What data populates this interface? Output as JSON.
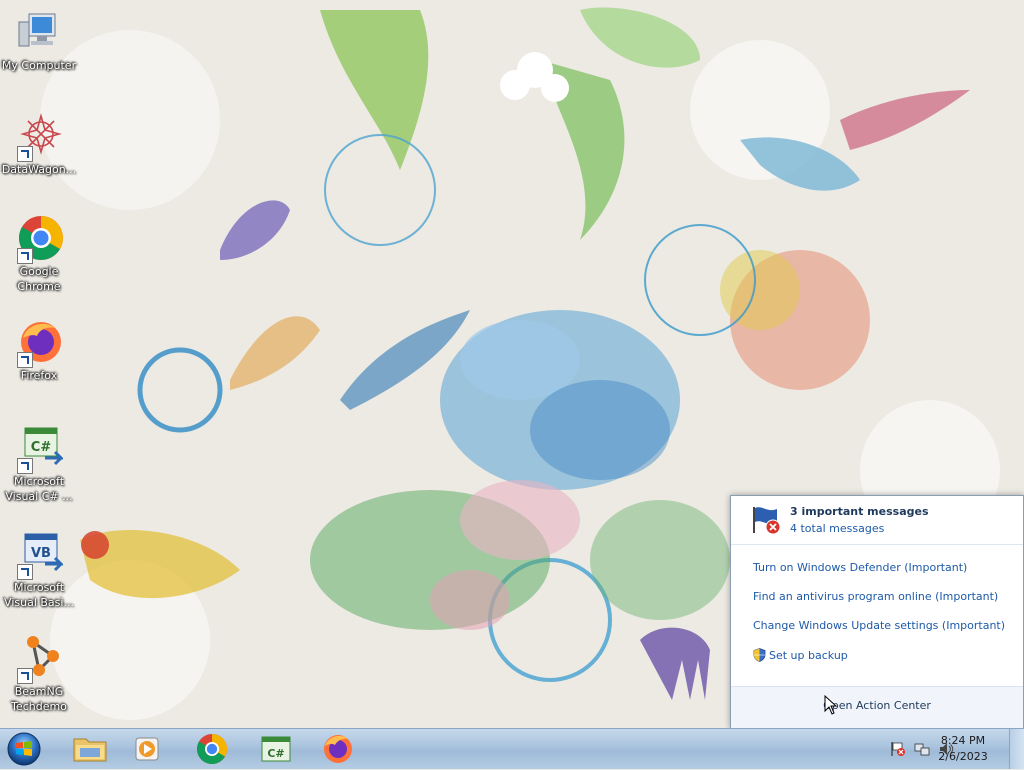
{
  "desktop": {
    "icons": [
      {
        "label": "My Computer",
        "icon": "computer-icon"
      },
      {
        "label": "DataWagon...",
        "icon": "datawagon-icon"
      },
      {
        "label": "Google Chrome",
        "icon": "chrome-icon"
      },
      {
        "label": "Firefox",
        "icon": "firefox-icon"
      },
      {
        "label": "Microsoft Visual C# ...",
        "icon": "visual-csharp-icon"
      },
      {
        "label": "Microsoft Visual Basi...",
        "icon": "visual-basic-icon"
      },
      {
        "label": "BeamNG Techdemo",
        "icon": "beamng-icon"
      }
    ]
  },
  "taskbar": {
    "start_icon": "windows-start-orb",
    "pinned": [
      {
        "name": "file-explorer",
        "icon": "folder-icon"
      },
      {
        "name": "media-player",
        "icon": "media-player-icon"
      },
      {
        "name": "google-chrome",
        "icon": "chrome-icon"
      },
      {
        "name": "visual-csharp",
        "icon": "visual-csharp-icon",
        "glyph": "C#"
      },
      {
        "name": "firefox",
        "icon": "firefox-icon"
      }
    ],
    "tray": {
      "icons": [
        "action-center-flag-icon",
        "network-icon",
        "volume-icon"
      ],
      "time": "8:24 PM",
      "date": "2/6/2023"
    }
  },
  "action_center": {
    "title": "3 important messages",
    "subtitle": "4 total messages",
    "items": [
      {
        "label": "Turn on Windows Defender (Important)"
      },
      {
        "label": "Find an antivirus program online (Important)"
      },
      {
        "label": "Change Windows Update settings (Important)"
      },
      {
        "label": "Set up backup",
        "icon": "uac-shield-icon"
      }
    ],
    "footer_link": "Open Action Center"
  },
  "colors": {
    "link": "#1e5aa8",
    "title": "#1e395b",
    "taskbar": "#a9c3de"
  }
}
